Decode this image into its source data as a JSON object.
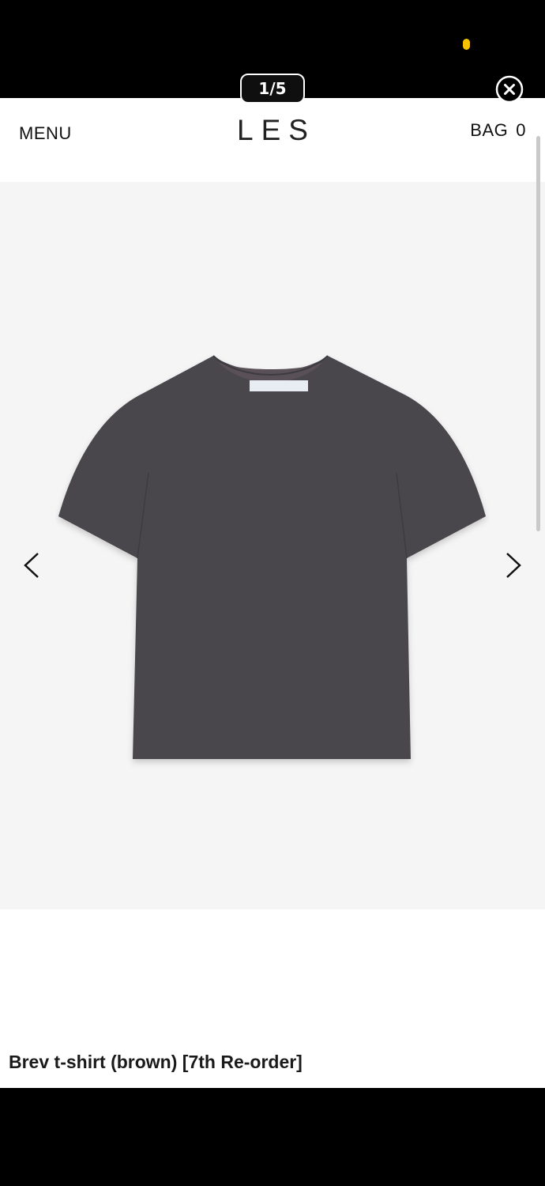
{
  "viewer": {
    "counter": "1/5"
  },
  "header": {
    "menu_label": "MENU",
    "logo": "LES",
    "bag_label": "BAG",
    "bag_count": "0"
  },
  "product": {
    "title": "Brev t-shirt (brown) [7th Re-order]"
  },
  "icons": {
    "close": "close-icon",
    "prev": "chevron-left-icon",
    "next": "chevron-right-icon"
  },
  "colors": {
    "status_dot": "#f5c400",
    "image_background": "#f5f5f5",
    "shirt": "#4a474c"
  }
}
